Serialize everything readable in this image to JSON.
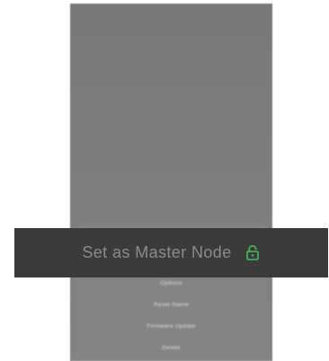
{
  "banner": {
    "label": "Set as Master Node",
    "icon": "unlock-icon",
    "icon_color": "#3dc25a"
  },
  "menu": {
    "items": [
      {
        "label": "Options"
      },
      {
        "label": "Reset Name"
      },
      {
        "label": "Firmware Update"
      },
      {
        "label": "Delete"
      }
    ]
  },
  "colors": {
    "panel": "#7e7e7e",
    "banner_bg": "#3b3b3b",
    "banner_text": "#8b8b8b"
  }
}
